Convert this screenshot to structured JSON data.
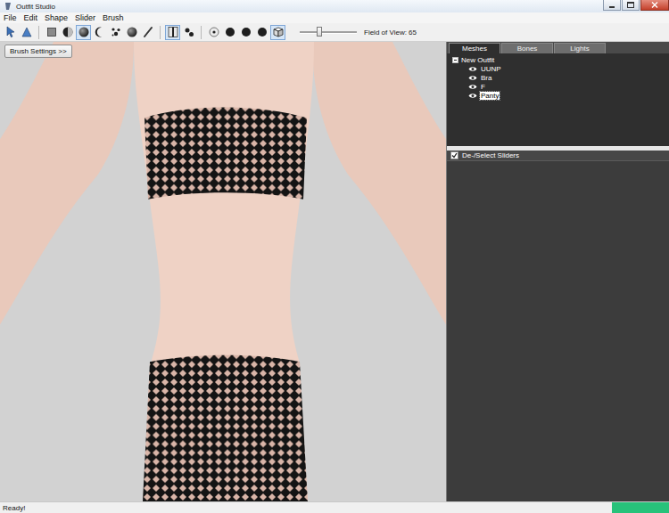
{
  "window": {
    "title": "Outfit Studio"
  },
  "menu": [
    "File",
    "Edit",
    "Shape",
    "Slider",
    "Brush"
  ],
  "toolbar": {
    "groups": [
      [
        {
          "kind": "select",
          "selected": false
        },
        {
          "kind": "transform",
          "selected": false
        }
      ],
      [
        {
          "kind": "square",
          "selected": false
        },
        {
          "kind": "half",
          "selected": false
        },
        {
          "kind": "sphere",
          "selected": true
        },
        {
          "kind": "crescent",
          "selected": false
        },
        {
          "kind": "scatter",
          "selected": false
        },
        {
          "kind": "sphere",
          "selected": false
        },
        {
          "kind": "brush",
          "selected": false
        }
      ],
      [
        {
          "kind": "split",
          "selected": true
        },
        {
          "kind": "pair",
          "selected": false
        }
      ],
      [
        {
          "kind": "dot",
          "selected": false
        },
        {
          "kind": "disc",
          "selected": false
        },
        {
          "kind": "disc",
          "selected": false
        },
        {
          "kind": "disc",
          "selected": false
        },
        {
          "kind": "cube",
          "selected": true
        }
      ]
    ],
    "fov": {
      "label": "Field of View: 65",
      "level": 0.35
    }
  },
  "viewport": {
    "brush_settings": "Brush Settings >>"
  },
  "tabs": [
    {
      "label": "Meshes",
      "selected": true
    },
    {
      "label": "Bones",
      "selected": false
    },
    {
      "label": "Lights",
      "selected": false
    }
  ],
  "tree": {
    "root": {
      "label": "New Outfit",
      "expanded": true
    },
    "items": [
      {
        "label": "UUNP",
        "visible": true,
        "selected": false
      },
      {
        "label": "Bra",
        "visible": true,
        "selected": false
      },
      {
        "label": "F",
        "visible": true,
        "selected": false
      },
      {
        "label": "Panty",
        "visible": true,
        "selected": true
      }
    ]
  },
  "sliders": {
    "label": "De-/Select Sliders",
    "checked": true
  },
  "status_bar": {
    "text": "Ready!"
  }
}
